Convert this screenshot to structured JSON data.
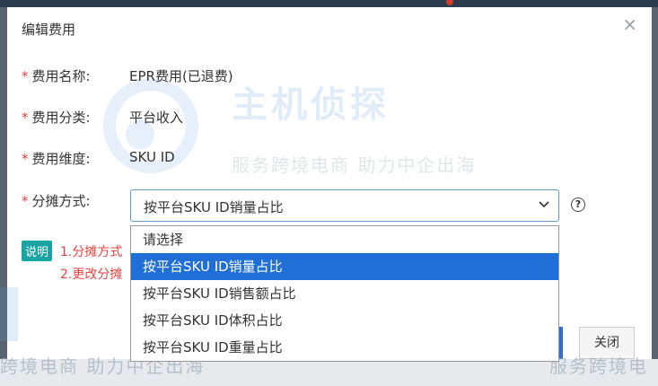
{
  "dialog": {
    "title": "编辑费用",
    "close_glyph": "×",
    "fields": [
      {
        "required": "*",
        "label": "费用名称:",
        "value": "EPR费用(已退费)"
      },
      {
        "required": "*",
        "label": "费用分类:",
        "value": "平台收入"
      },
      {
        "required": "*",
        "label": "费用维度:",
        "value": "SKU ID"
      },
      {
        "required": "*",
        "label": "分摊方式:",
        "selected": "按平台SKU ID销量占比"
      }
    ],
    "help_glyph": "?",
    "note": {
      "tag": "说明",
      "line1": "1.分摊方式",
      "line2": "2.更改分摊"
    },
    "close_button": "关闭"
  },
  "dropdown": {
    "options": [
      "请选择",
      "按平台SKU ID销量占比",
      "按平台SKU ID销售额占比",
      "按平台SKU ID体积占比",
      "按平台SKU ID重量占比"
    ],
    "selected_index": 1
  },
  "watermark": {
    "brand": "主机侦探",
    "slogan": "服务跨境电商 助力中企出海",
    "slogan_partial_left": "跨境电商 助力中企出海",
    "slogan_partial_right": "服务跨境电"
  },
  "colors": {
    "accent": "#1f6fd6",
    "required": "#e64340",
    "note_tag": "#1aa3a3"
  }
}
